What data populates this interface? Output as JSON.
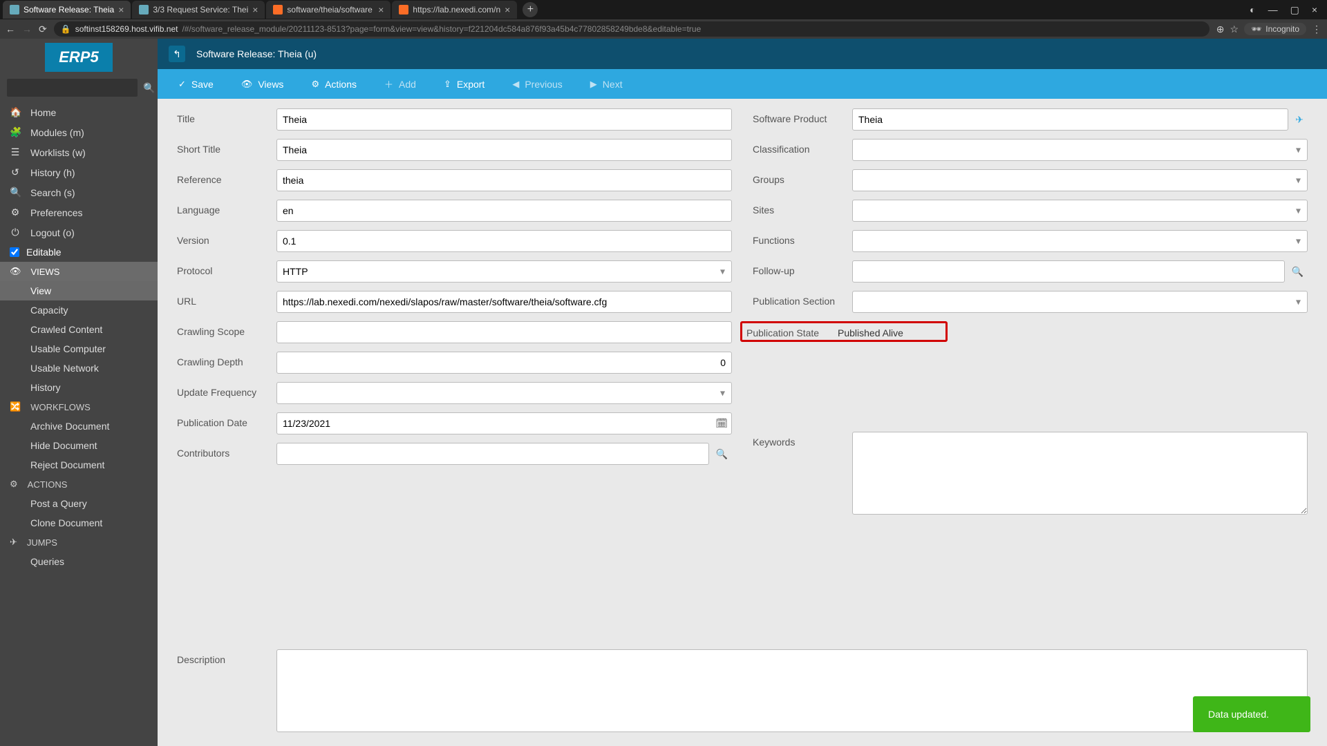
{
  "browser": {
    "tabs": [
      {
        "label": "Software Release: Theia",
        "active": true,
        "favicon": "erp5"
      },
      {
        "label": "3/3 Request Service: Thei",
        "active": false,
        "favicon": "erp5"
      },
      {
        "label": "software/theia/software",
        "active": false,
        "favicon": "gitlab"
      },
      {
        "label": "https://lab.nexedi.com/n",
        "active": false,
        "favicon": "gitlab"
      }
    ],
    "url_host": "softinst158269.host.vifib.net",
    "url_path": "/#/software_release_module/20211123-8513?page=form&view=view&history=f221204dc584a876f93a45b4c77802858249bde8&editable=true",
    "incognito": "Incognito"
  },
  "sidebar": {
    "logo": "ERP5",
    "searchPlaceholder": "",
    "nav": [
      {
        "icon": "home",
        "label": "Home"
      },
      {
        "icon": "modules",
        "label": "Modules (m)"
      },
      {
        "icon": "worklists",
        "label": "Worklists (w)"
      },
      {
        "icon": "history",
        "label": "History (h)"
      },
      {
        "icon": "search",
        "label": "Search (s)"
      },
      {
        "icon": "prefs",
        "label": "Preferences"
      },
      {
        "icon": "logout",
        "label": "Logout (o)"
      }
    ],
    "editable": "Editable",
    "views": {
      "head": "VIEWS",
      "items": [
        "View",
        "Capacity",
        "Crawled Content",
        "Usable Computer",
        "Usable Network",
        "History"
      ]
    },
    "workflows": {
      "head": "WORKFLOWS",
      "items": [
        "Archive Document",
        "Hide Document",
        "Reject Document"
      ]
    },
    "actions": {
      "head": "ACTIONS",
      "items": [
        "Post a Query",
        "Clone Document"
      ]
    },
    "jumps": {
      "head": "JUMPS",
      "items": [
        "Queries"
      ]
    }
  },
  "breadcrumb": "Software Release: Theia (u)",
  "toolbar": {
    "save": "Save",
    "views": "Views",
    "actions": "Actions",
    "add": "Add",
    "export": "Export",
    "previous": "Previous",
    "next": "Next"
  },
  "form": {
    "left": {
      "title": {
        "label": "Title",
        "value": "Theia"
      },
      "short_title": {
        "label": "Short Title",
        "value": "Theia"
      },
      "reference": {
        "label": "Reference",
        "value": "theia"
      },
      "language": {
        "label": "Language",
        "value": "en"
      },
      "version": {
        "label": "Version",
        "value": "0.1"
      },
      "protocol": {
        "label": "Protocol",
        "value": "HTTP"
      },
      "url": {
        "label": "URL",
        "value": "https://lab.nexedi.com/nexedi/slapos/raw/master/software/theia/software.cfg"
      },
      "crawling_scope": {
        "label": "Crawling Scope",
        "value": ""
      },
      "crawling_depth": {
        "label": "Crawling Depth",
        "value": "0"
      },
      "update_frequency": {
        "label": "Update Frequency",
        "value": ""
      },
      "publication_date": {
        "label": "Publication Date",
        "value": "11/23/2021"
      },
      "contributors": {
        "label": "Contributors",
        "value": ""
      }
    },
    "right": {
      "software_product": {
        "label": "Software Product",
        "value": "Theia"
      },
      "classification": {
        "label": "Classification",
        "value": ""
      },
      "groups": {
        "label": "Groups",
        "value": ""
      },
      "sites": {
        "label": "Sites",
        "value": ""
      },
      "functions": {
        "label": "Functions",
        "value": ""
      },
      "followup": {
        "label": "Follow-up",
        "value": ""
      },
      "publication_section": {
        "label": "Publication Section",
        "value": ""
      },
      "publication_state": {
        "label": "Publication State",
        "value": "Published Alive"
      },
      "keywords": {
        "label": "Keywords",
        "value": ""
      }
    },
    "description": {
      "label": "Description",
      "value": ""
    }
  },
  "toast": "Data updated."
}
